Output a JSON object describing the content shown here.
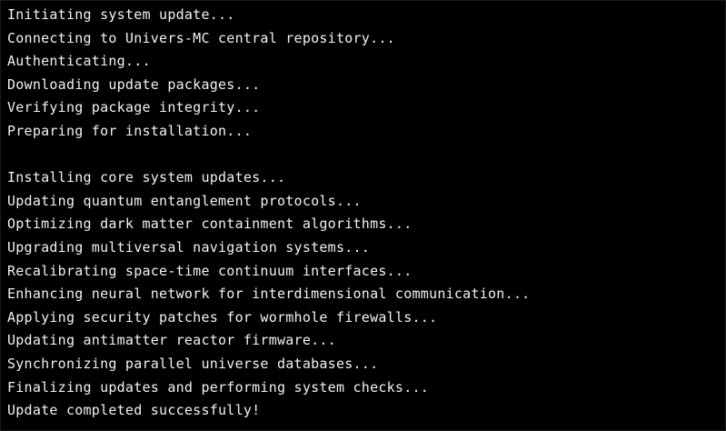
{
  "colors": {
    "background": "#000000",
    "text": "#f2f2f2"
  },
  "terminal": {
    "lines": [
      "Initiating system update...",
      "Connecting to Univers-MC central repository...",
      "Authenticating...",
      "Downloading update packages...",
      "Verifying package integrity...",
      "Preparing for installation...",
      "",
      "Installing core system updates...",
      "Updating quantum entanglement protocols...",
      "Optimizing dark matter containment algorithms...",
      "Upgrading multiversal navigation systems...",
      "Recalibrating space-time continuum interfaces...",
      "Enhancing neural network for interdimensional communication...",
      "Applying security patches for wormhole firewalls...",
      "Updating antimatter reactor firmware...",
      "Synchronizing parallel universe databases...",
      "Finalizing updates and performing system checks...",
      "Update completed successfully!"
    ]
  }
}
